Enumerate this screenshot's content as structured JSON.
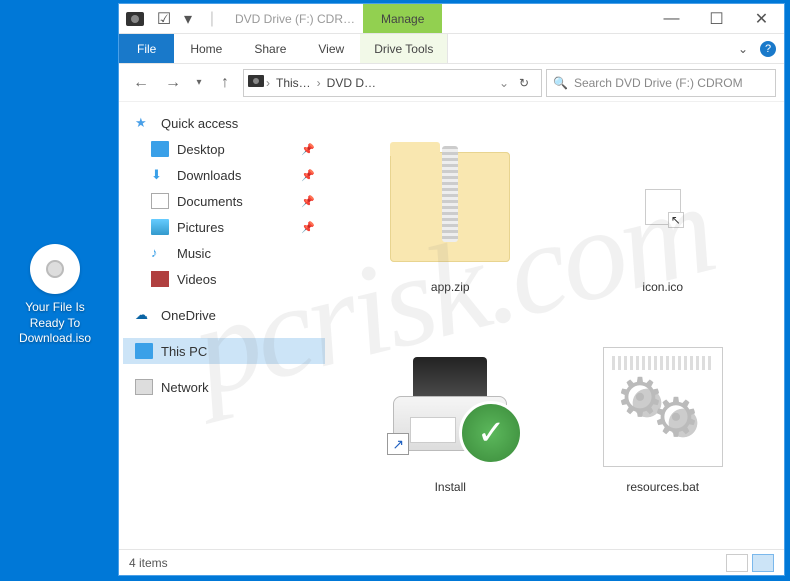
{
  "desktop_icon": {
    "label": "Your File Is Ready To Download.iso"
  },
  "titlebar": {
    "title": "DVD Drive (F:) CDR…",
    "manage": "Manage",
    "min": "—",
    "max": "☐",
    "close": "✕"
  },
  "ribbon": {
    "file": "File",
    "tabs": [
      "Home",
      "Share",
      "View"
    ],
    "drive_tools": "Drive Tools",
    "help": "?"
  },
  "nav": {
    "back": "←",
    "fwd": "→",
    "dd": "▾",
    "up": "↑",
    "crumbs": [
      "This…",
      "DVD D…"
    ],
    "refresh": "↻",
    "search_placeholder": "Search DVD Drive (F:) CDROM"
  },
  "sidebar": {
    "quick": "Quick access",
    "items": [
      {
        "label": "Desktop",
        "pinned": true
      },
      {
        "label": "Downloads",
        "pinned": true
      },
      {
        "label": "Documents",
        "pinned": true
      },
      {
        "label": "Pictures",
        "pinned": true
      },
      {
        "label": "Music",
        "pinned": false
      },
      {
        "label": "Videos",
        "pinned": false
      }
    ],
    "onedrive": "OneDrive",
    "thispc": "This PC",
    "network": "Network"
  },
  "files": [
    {
      "name": "app.zip"
    },
    {
      "name": "icon.ico"
    },
    {
      "name": "Install"
    },
    {
      "name": "resources.bat"
    }
  ],
  "status": {
    "count": "4 items"
  },
  "watermark": "pcrisk.com"
}
